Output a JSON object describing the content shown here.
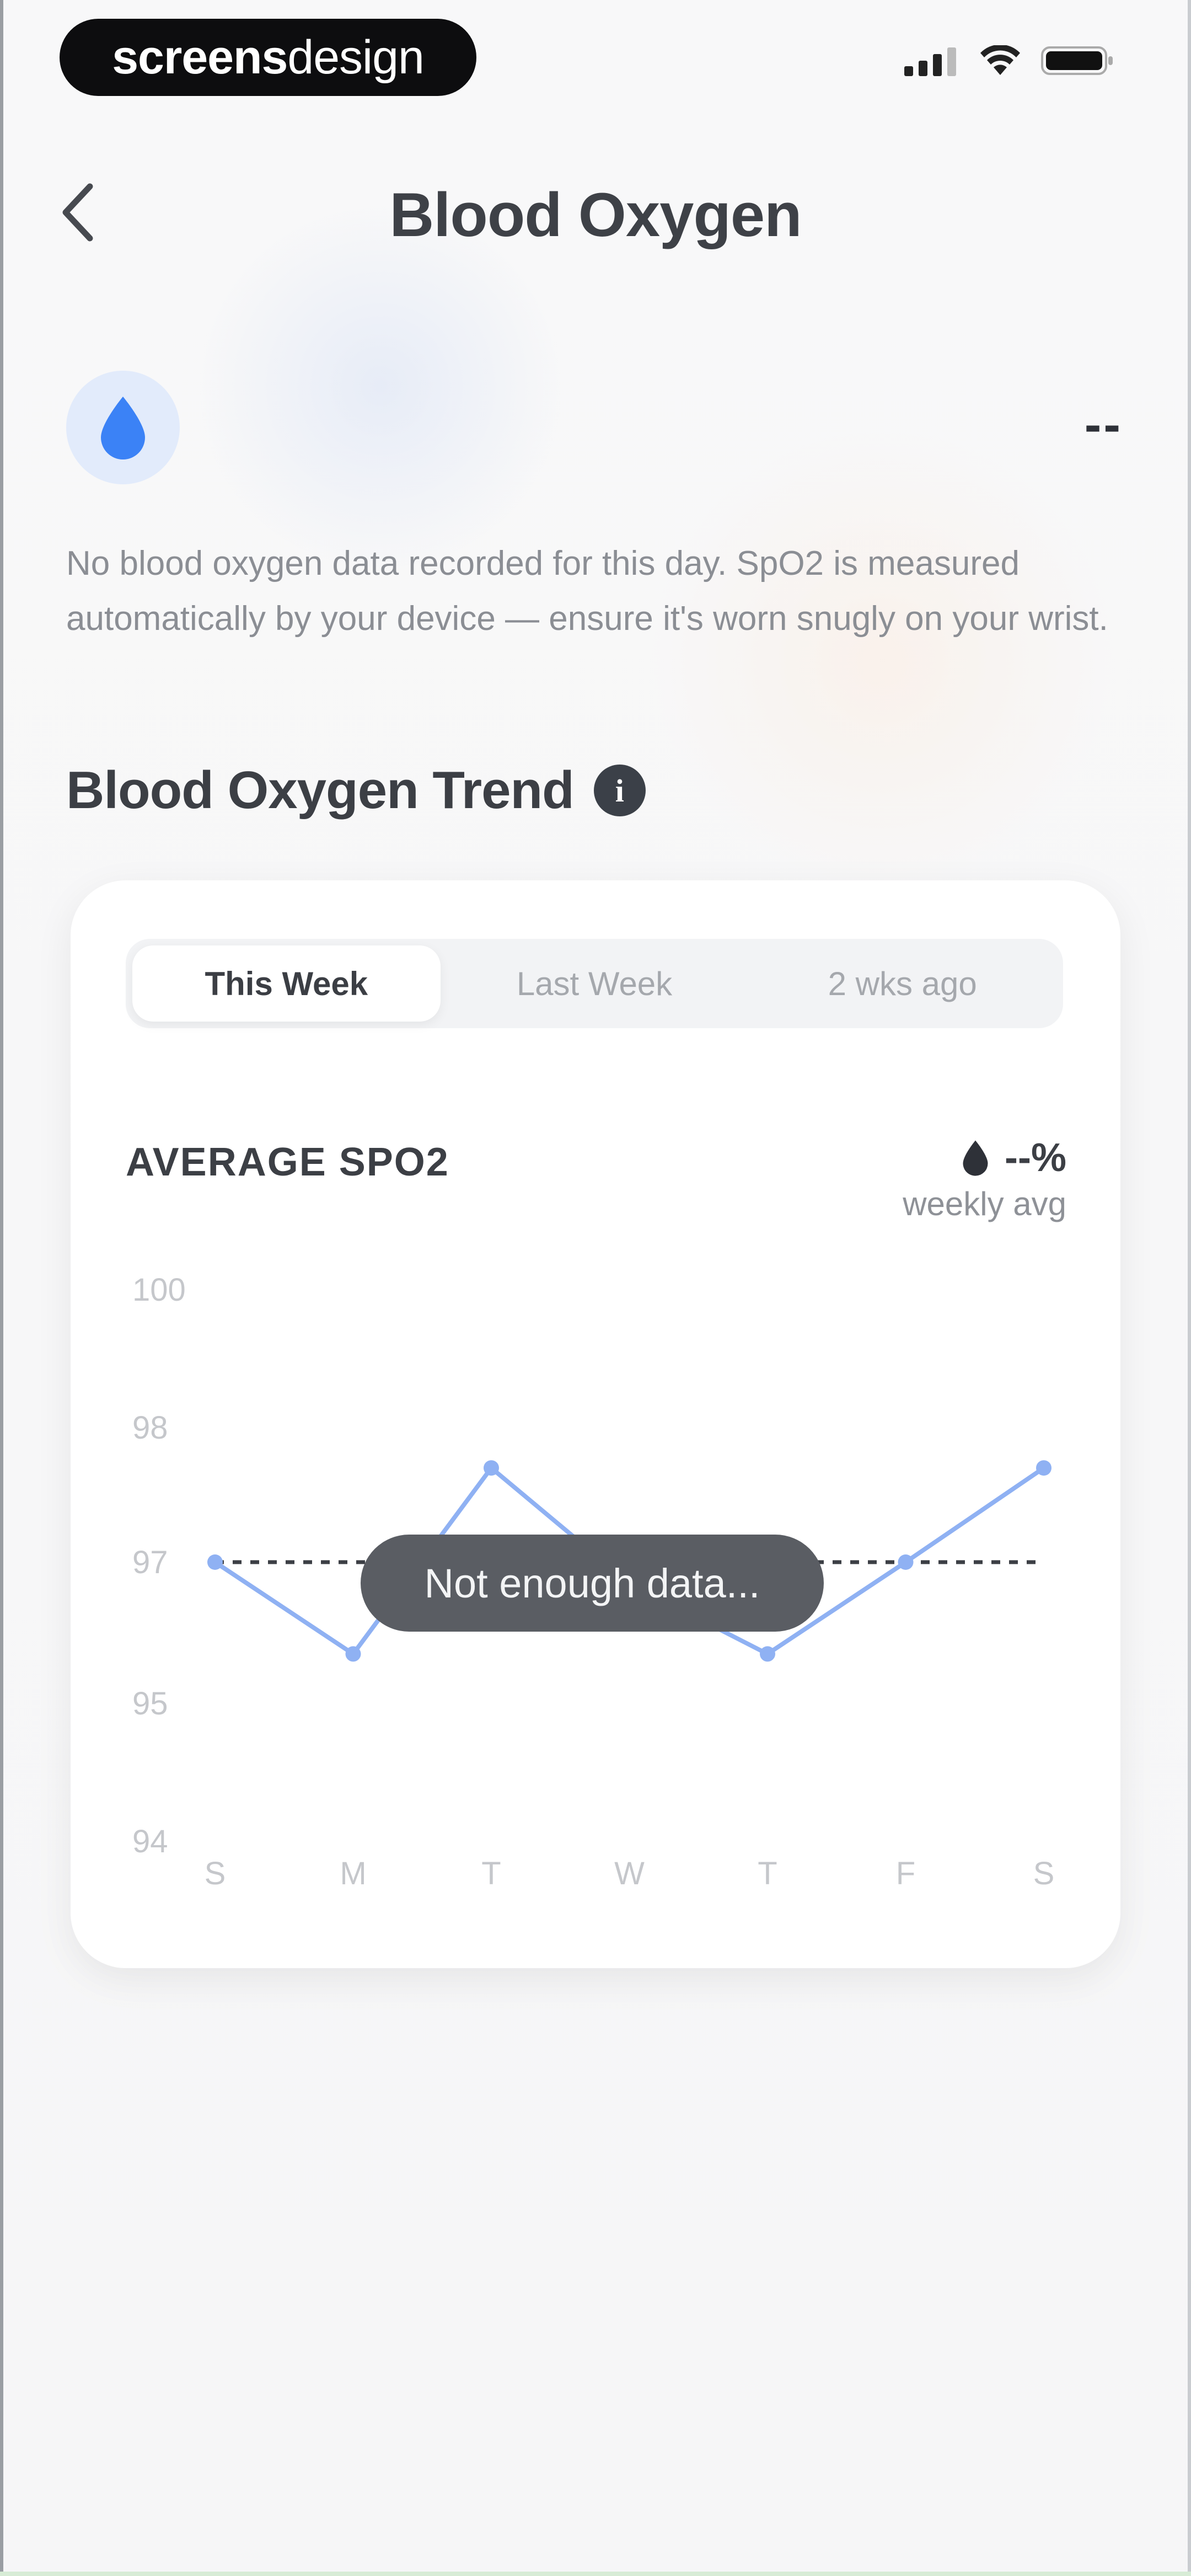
{
  "status_bar": {
    "brand_bold": "screens",
    "brand_light": "design",
    "icons": [
      "signal-icon",
      "wifi-icon",
      "battery-icon"
    ]
  },
  "nav": {
    "back_icon": "chevron-left-icon",
    "title": "Blood Oxygen"
  },
  "summary": {
    "icon": "water-drop-icon",
    "value": "--",
    "message": "No blood oxygen data recorded for this day. SpO2 is measured automatically by your device — ensure it's worn snugly on your wrist."
  },
  "trend": {
    "title": "Blood Oxygen Trend",
    "info_icon": "i",
    "tabs": [
      {
        "label": "This Week",
        "selected": true
      },
      {
        "label": "Last Week",
        "selected": false
      },
      {
        "label": "2 wks ago",
        "selected": false
      }
    ],
    "metric_label": "AVERAGE SPO2",
    "weekly_value": "--%",
    "weekly_label": "weekly avg",
    "empty_message": "Not enough data..."
  },
  "colors": {
    "accent": "#3b82f6",
    "line": "#8fb1f3",
    "toast": "#5a5d63"
  },
  "chart_data": {
    "type": "line",
    "categories": [
      "S",
      "M",
      "T",
      "W",
      "T",
      "F",
      "S"
    ],
    "y_ticks": [
      "100",
      "98",
      "97",
      "95",
      "94"
    ],
    "series": [
      {
        "values": [
          97,
          95.7,
          97.7,
          96.7,
          95.7,
          97,
          97.7
        ]
      }
    ],
    "reference_line": 97,
    "ylim": [
      94,
      100
    ],
    "grid": false
  }
}
